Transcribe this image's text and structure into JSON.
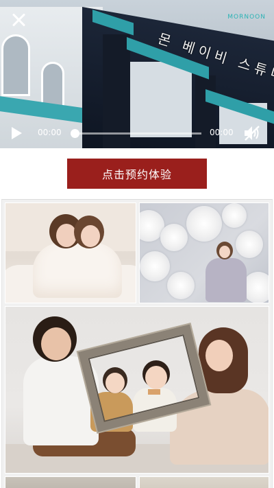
{
  "video": {
    "current_time": "00:00",
    "duration": "00:00",
    "progress": 0.0,
    "sign_text": "몬 베이비 스튜디오",
    "brand_text": "MORNOON"
  },
  "cta": {
    "label": "点击预约体验",
    "color": "#9a1f1c"
  },
  "gallery": {
    "photos": [
      {
        "subject": "mother-daughter-photo"
      },
      {
        "subject": "girl-with-flowers-photo"
      },
      {
        "subject": "family-frame-photo"
      },
      {
        "subject": "photo-4"
      },
      {
        "subject": "photo-5"
      }
    ]
  },
  "icons": {
    "close": "close-icon",
    "play": "play-icon",
    "mute": "speaker-muted-icon"
  }
}
